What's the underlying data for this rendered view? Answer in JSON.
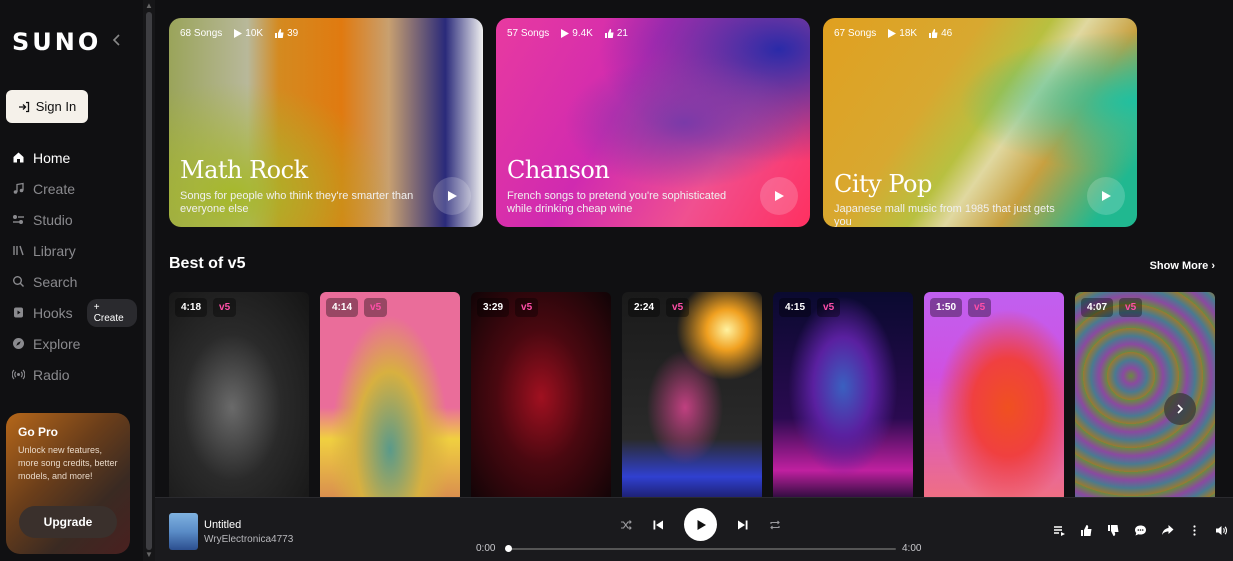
{
  "sidebar": {
    "logo": "SUNO",
    "sign_in": "Sign In",
    "nav": [
      {
        "label": "Home",
        "icon": "home-icon"
      },
      {
        "label": "Create",
        "icon": "music-note-icon"
      },
      {
        "label": "Studio",
        "icon": "studio-icon"
      },
      {
        "label": "Library",
        "icon": "library-icon"
      },
      {
        "label": "Search",
        "icon": "search-icon"
      },
      {
        "label": "Hooks",
        "icon": "hooks-icon"
      },
      {
        "label": "Explore",
        "icon": "compass-icon"
      },
      {
        "label": "Radio",
        "icon": "radio-icon"
      }
    ],
    "hooks_create": "+ Create",
    "go_pro": {
      "title": "Go Pro",
      "text": "Unlock new features, more song credits, better models, and more!",
      "button": "Upgrade"
    }
  },
  "playlists": [
    {
      "songs": "68 Songs",
      "plays": "10K",
      "likes": "39",
      "title": "Math Rock",
      "description": "Songs for people who think they're smarter than everyone else"
    },
    {
      "songs": "57 Songs",
      "plays": "9.4K",
      "likes": "21",
      "title": "Chanson",
      "description": "French songs to pretend you're sophisticated while drinking cheap wine"
    },
    {
      "songs": "67 Songs",
      "plays": "18K",
      "likes": "46",
      "title": "City Pop",
      "description": "Japanese mall music from 1985 that just gets you"
    }
  ],
  "section": {
    "title": "Best of v5",
    "show_more": "Show More"
  },
  "songs": [
    {
      "duration": "4:18",
      "version": "v5"
    },
    {
      "duration": "4:14",
      "version": "v5"
    },
    {
      "duration": "3:29",
      "version": "v5"
    },
    {
      "duration": "2:24",
      "version": "v5"
    },
    {
      "duration": "4:15",
      "version": "v5"
    },
    {
      "duration": "1:50",
      "version": "v5"
    },
    {
      "duration": "4:07",
      "version": "v5"
    }
  ],
  "player": {
    "title": "Untitled",
    "artist": "WryElectronica4773",
    "current_time": "0:00",
    "total_time": "4:00",
    "progress": 0
  },
  "colors": {
    "accent_v5": "#ff4fa8",
    "background": "#101012"
  }
}
